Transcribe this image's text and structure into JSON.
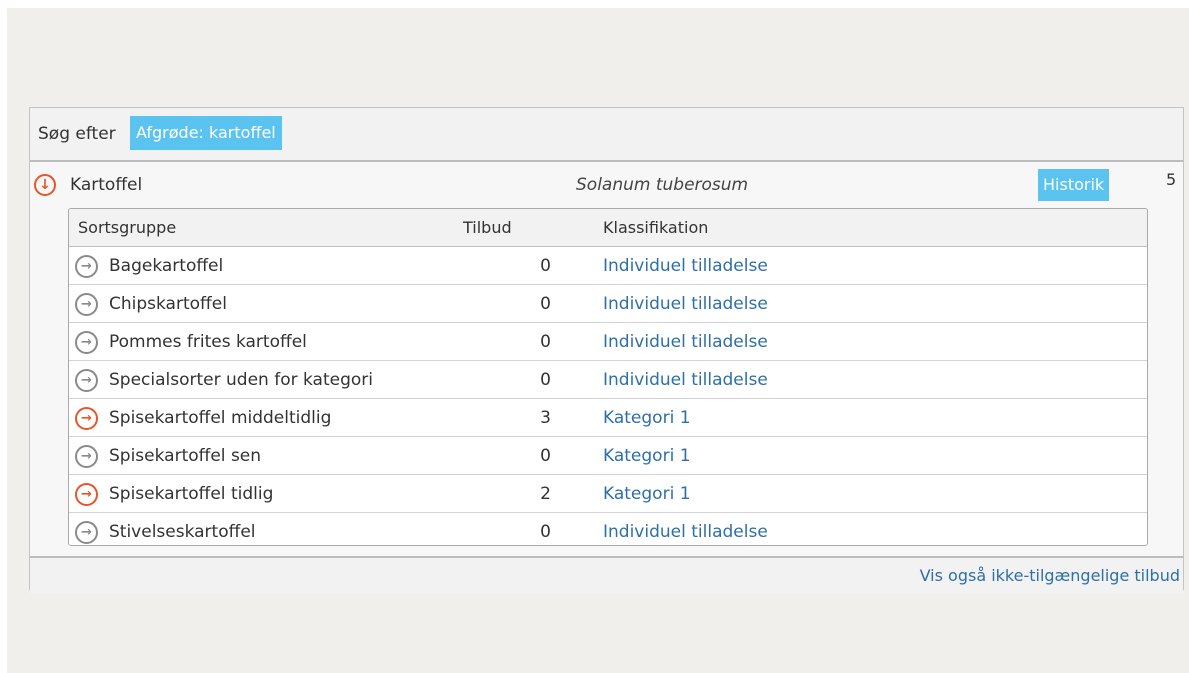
{
  "search": {
    "label": "Søg efter",
    "filter_chip": "Afgrøde: kartoffel"
  },
  "crop": {
    "name": "Kartoffel",
    "latin_name": "Solanum tuberosum",
    "history_button": "Historik",
    "count": "5",
    "expand_icon": "arrow-down-circle-icon"
  },
  "table": {
    "headers": {
      "group": "Sortsgruppe",
      "offers": "Tilbud",
      "classification": "Klassifikation"
    },
    "rows": [
      {
        "name": "Bagekartoffel",
        "offers": "0",
        "classification": "Individuel tilladelse",
        "active": false
      },
      {
        "name": "Chipskartoffel",
        "offers": "0",
        "classification": "Individuel tilladelse",
        "active": false
      },
      {
        "name": "Pommes frites kartoffel",
        "offers": "0",
        "classification": "Individuel tilladelse",
        "active": false
      },
      {
        "name": "Specialsorter uden for kategori",
        "offers": "0",
        "classification": "Individuel tilladelse",
        "active": false
      },
      {
        "name": "Spisekartoffel middeltidlig",
        "offers": "3",
        "classification": "Kategori 1",
        "active": true
      },
      {
        "name": "Spisekartoffel sen",
        "offers": "0",
        "classification": "Kategori 1",
        "active": false
      },
      {
        "name": "Spisekartoffel tidlig",
        "offers": "2",
        "classification": "Kategori 1",
        "active": true
      },
      {
        "name": "Stivelseskartoffel",
        "offers": "0",
        "classification": "Individuel tilladelse",
        "active": false
      }
    ],
    "row_icon": "arrow-right-circle-icon"
  },
  "footer": {
    "link": "Vis også ikke-tilgængelige tilbud"
  },
  "colors": {
    "accent": "#5bc3ef",
    "active_icon": "#e8552b",
    "inactive_icon": "#8a8a8a",
    "link": "#2e6fa8"
  }
}
